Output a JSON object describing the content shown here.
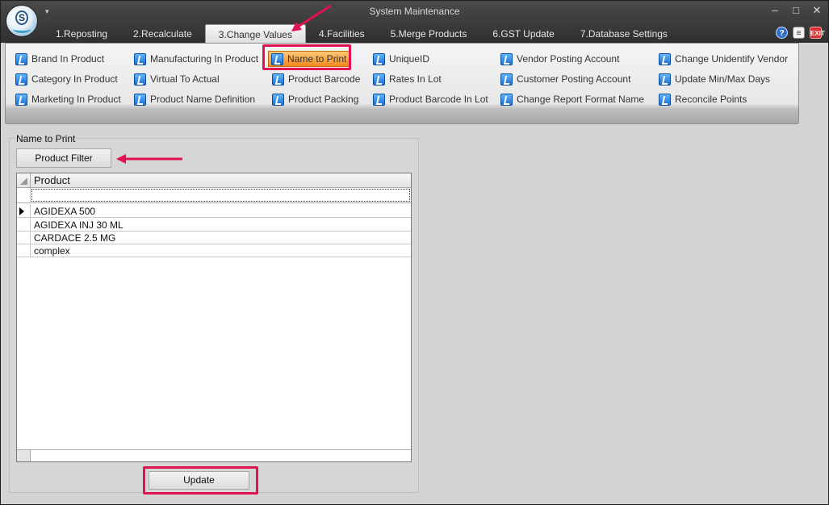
{
  "window": {
    "title": "System Maintenance",
    "controls": {
      "minimize": "–",
      "maximize": "□",
      "close": "✕"
    },
    "quick_access": "▾"
  },
  "tabs": [
    {
      "label": "1.Reposting"
    },
    {
      "label": "2.Recalculate"
    },
    {
      "label": "3.Change Values",
      "active": true
    },
    {
      "label": "4.Facilities"
    },
    {
      "label": "5.Merge Products"
    },
    {
      "label": "6.GST Update"
    },
    {
      "label": "7.Database Settings"
    }
  ],
  "right_icons": {
    "help": "?",
    "doc": "≡",
    "exit": "EXIT"
  },
  "ribbon": {
    "col1": [
      "Brand In Product",
      "Category In Product",
      "Marketing In Product"
    ],
    "col2": [
      "Manufacturing In Product",
      "Virtual To Actual",
      "Product Name Definition"
    ],
    "col3": [
      "Name to Print",
      "Product Barcode",
      "Product Packing"
    ],
    "col4": [
      "UniqueID",
      "Rates In Lot",
      "Product Barcode In Lot"
    ],
    "col5": [
      "Vendor Posting Account",
      "Customer Posting Account",
      "Change Report Format Name"
    ],
    "col6": [
      "Change Unidentify Vendor",
      "Update Min/Max Days",
      "Reconcile Points"
    ],
    "selected": "Name to Print"
  },
  "panel": {
    "title": "Name to Print",
    "filter_button": "Product Filter",
    "grid": {
      "column": "Product",
      "filter_value": "",
      "rows": [
        "AGIDEXA 500",
        "AGIDEXA INJ 30 ML",
        "CARDACE 2.5 MG",
        "complex"
      ]
    },
    "update_button": "Update"
  },
  "colors": {
    "highlight": "#e0124f",
    "selected_button": "#f28a1c",
    "ribbon_icon": "#1c6fd1"
  }
}
